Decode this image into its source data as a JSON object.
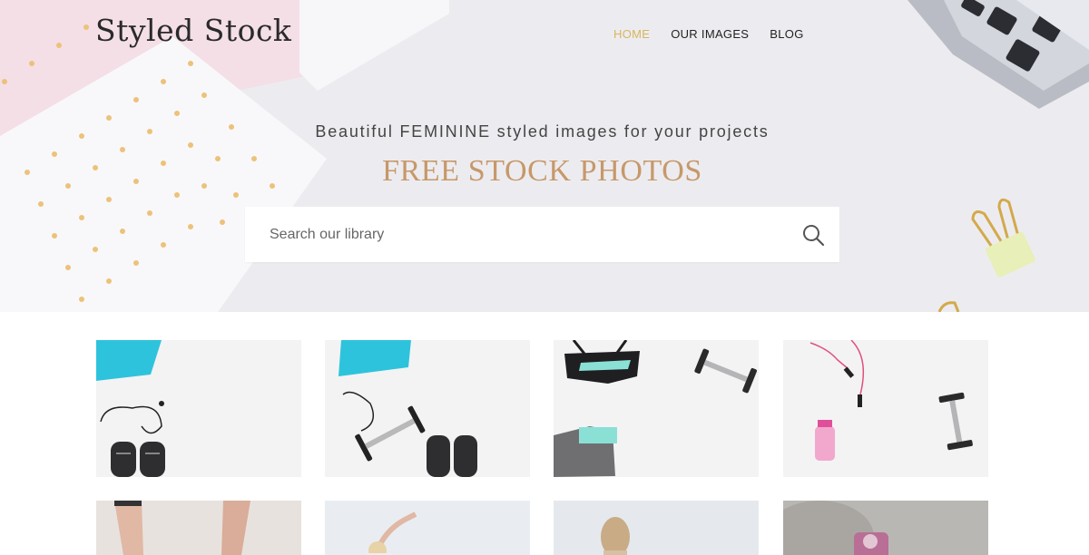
{
  "brand": {
    "logo_text": "Styled Stock"
  },
  "nav": {
    "items": [
      {
        "label": "HOME",
        "active": true
      },
      {
        "label": "OUR IMAGES",
        "active": false
      },
      {
        "label": "BLOG",
        "active": false
      }
    ]
  },
  "hero": {
    "tagline": "Beautiful FEMININE styled images for your projects",
    "headline": "FREE STOCK PHOTOS"
  },
  "search": {
    "placeholder": "Search our library",
    "value": ""
  },
  "colors": {
    "accent_gold": "#d9b65e",
    "headline_tan": "#c7986a",
    "towel_cyan": "#2ec3dc",
    "hero_bg": "#ececf0"
  },
  "gallery": {
    "row1": [
      {
        "subject": "cyan towel, earphones, sneakers"
      },
      {
        "subject": "cyan towel, earphones, dumbbell, sneakers"
      },
      {
        "subject": "sports bra, dumbbell, leggings"
      },
      {
        "subject": "pink jump rope, water bottle, dumbbell"
      }
    ],
    "row2": [
      {
        "subject": "legs"
      },
      {
        "subject": "stretching woman"
      },
      {
        "subject": "woman with ponytail"
      },
      {
        "subject": "pink water bottle outdoors"
      }
    ]
  }
}
